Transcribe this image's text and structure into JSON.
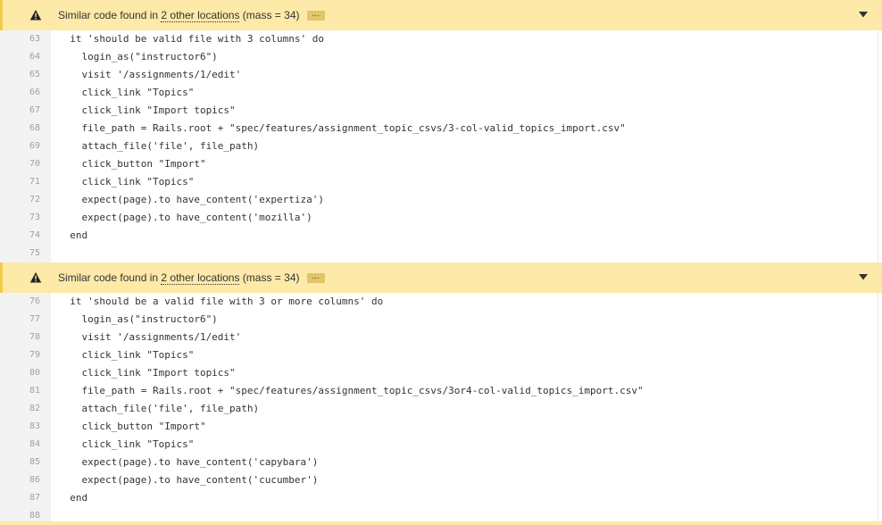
{
  "issue_1": {
    "prefix": "Similar code found in ",
    "link": "2 other locations",
    "suffix": " (mass = 34)",
    "more_label": "..."
  },
  "issue_2": {
    "prefix": "Similar code found in ",
    "link": "2 other locations",
    "suffix": " (mass = 34)",
    "more_label": "..."
  },
  "block_1": {
    "lines": [
      {
        "num": "63",
        "text": "  it 'should be valid file with 3 columns' do"
      },
      {
        "num": "64",
        "text": "    login_as(\"instructor6\")"
      },
      {
        "num": "65",
        "text": "    visit '/assignments/1/edit'"
      },
      {
        "num": "66",
        "text": "    click_link \"Topics\""
      },
      {
        "num": "67",
        "text": "    click_link \"Import topics\""
      },
      {
        "num": "68",
        "text": "    file_path = Rails.root + \"spec/features/assignment_topic_csvs/3-col-valid_topics_import.csv\""
      },
      {
        "num": "69",
        "text": "    attach_file('file', file_path)"
      },
      {
        "num": "70",
        "text": "    click_button \"Import\""
      },
      {
        "num": "71",
        "text": "    click_link \"Topics\""
      },
      {
        "num": "72",
        "text": "    expect(page).to have_content('expertiza')"
      },
      {
        "num": "73",
        "text": "    expect(page).to have_content('mozilla')"
      },
      {
        "num": "74",
        "text": "  end"
      },
      {
        "num": "75",
        "text": ""
      }
    ]
  },
  "block_2": {
    "lines": [
      {
        "num": "76",
        "text": "  it 'should be a valid file with 3 or more columns' do"
      },
      {
        "num": "77",
        "text": "    login_as(\"instructor6\")"
      },
      {
        "num": "78",
        "text": "    visit '/assignments/1/edit'"
      },
      {
        "num": "79",
        "text": "    click_link \"Topics\""
      },
      {
        "num": "80",
        "text": "    click_link \"Import topics\""
      },
      {
        "num": "81",
        "text": "    file_path = Rails.root + \"spec/features/assignment_topic_csvs/3or4-col-valid_topics_import.csv\""
      },
      {
        "num": "82",
        "text": "    attach_file('file', file_path)"
      },
      {
        "num": "83",
        "text": "    click_button \"Import\""
      },
      {
        "num": "84",
        "text": "    click_link \"Topics\""
      },
      {
        "num": "85",
        "text": "    expect(page).to have_content('capybara')"
      },
      {
        "num": "86",
        "text": "    expect(page).to have_content('cucumber')"
      },
      {
        "num": "87",
        "text": "  end"
      },
      {
        "num": "88",
        "text": ""
      }
    ]
  },
  "icons": {
    "warning": "warning-triangle-icon",
    "expand": "caret-down-icon"
  },
  "colors": {
    "issue_bg": "#fde9a8",
    "issue_accent": "#f2c94c",
    "gutter_bg": "#f3f3f3",
    "line_number": "#a0a0a0",
    "code_text": "#333333"
  }
}
